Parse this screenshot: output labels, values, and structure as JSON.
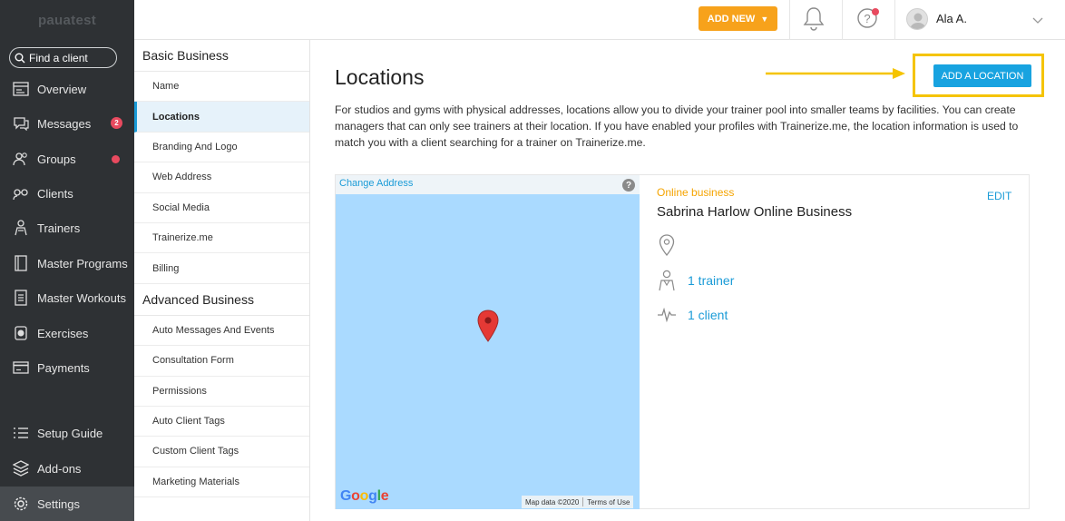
{
  "brand": "pauatest",
  "search": {
    "label": "Find a client"
  },
  "nav": {
    "overview": "Overview",
    "messages": "Messages",
    "messages_badge": "2",
    "groups": "Groups",
    "clients": "Clients",
    "trainers": "Trainers",
    "master_programs": "Master Programs",
    "master_workouts": "Master Workouts",
    "exercises": "Exercises",
    "payments": "Payments",
    "setup_guide": "Setup Guide",
    "addons": "Add-ons",
    "settings": "Settings"
  },
  "topbar": {
    "add_new": "ADD NEW",
    "user_name": "Ala A."
  },
  "settings_menu": {
    "basic_title": "Basic Business",
    "basic_items": [
      "Name",
      "Locations",
      "Branding And Logo",
      "Web Address",
      "Social Media",
      "Trainerize.me",
      "Billing"
    ],
    "advanced_title": "Advanced Business",
    "advanced_items": [
      "Auto Messages And Events",
      "Consultation Form",
      "Permissions",
      "Auto Client Tags",
      "Custom Client Tags",
      "Marketing Materials"
    ]
  },
  "main": {
    "title": "Locations",
    "add_location": "ADD A LOCATION",
    "description": "For studios and gyms with physical addresses, locations allow you to divide your trainer pool into smaller teams by facilities. You can create managers that can only see trainers at their location. If you have enabled your profiles with Trainerize.me, the location information is used to match you with a client searching for a trainer on Trainerize.me."
  },
  "location": {
    "change_address": "Change Address",
    "help_glyph": "?",
    "map_data": "Map data ©2020",
    "terms": "Terms of Use",
    "google": [
      "G",
      "o",
      "o",
      "g",
      "l",
      "e"
    ],
    "type": "Online business",
    "name": "Sabrina Harlow Online Business",
    "edit": "EDIT",
    "trainers": "1 trainer",
    "clients": "1 client"
  },
  "colors": {
    "sidebar_bg": "#2e3134",
    "accent_orange": "#f7a21b",
    "accent_blue": "#18a3e0",
    "highlight_yellow": "#f5c400",
    "badge_red": "#e84a5f"
  }
}
